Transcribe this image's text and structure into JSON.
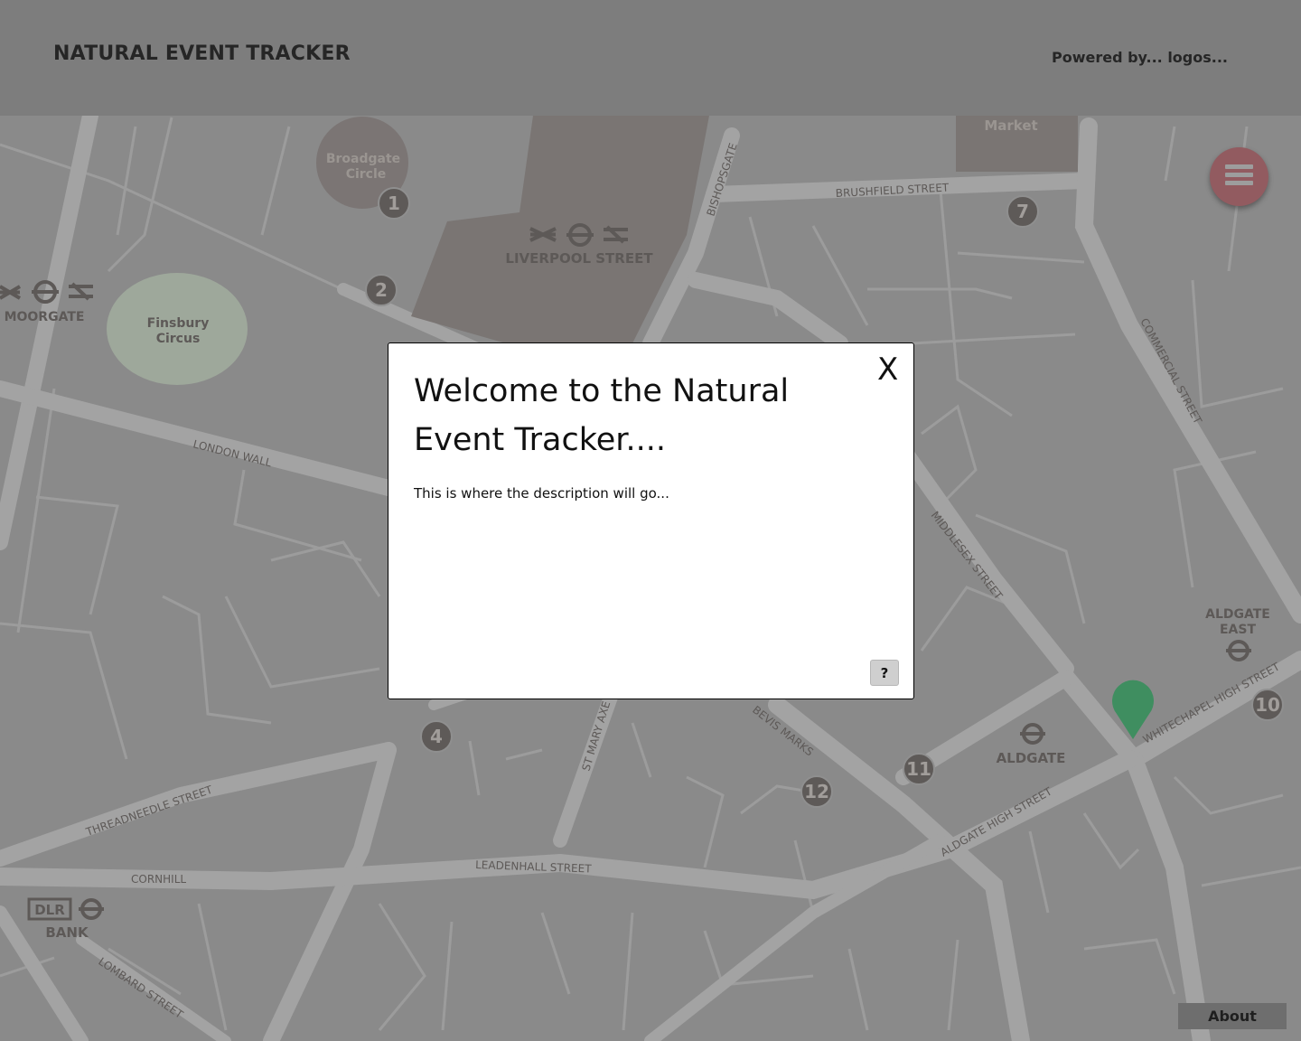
{
  "header": {
    "title": "NATURAL EVENT TRACKER",
    "powered_by": "Powered by... logos..."
  },
  "map": {
    "labels": {
      "broadgate_line1": "Broadgate",
      "broadgate_line2": "Circle",
      "liverpool_street": "LIVERPOOL STREET",
      "moorgate": "MOORGATE",
      "finsbury_line1": "Finsbury",
      "finsbury_line2": "Circus",
      "bishopsgate": "BISHOPSGATE",
      "brushfield_street": "BRUSHFIELD STREET",
      "market": "Market",
      "commercial_street": "COMMERCIAL STREET",
      "london_wall": "LONDON WALL",
      "middlesex_street": "MIDDLESEX STREET",
      "aldgate_east_line1": "ALDGATE",
      "aldgate_east_line2": "EAST",
      "whitechapel_high_street": "WHITECHAPEL HIGH STREET",
      "aldgate": "ALDGATE",
      "aldgate_high_street": "ALDGATE HIGH STREET",
      "bevis_marks": "BEVIS MARKS",
      "st_mary_axe": "ST MARY AXE",
      "threadneedle_street": "THREADNEEDLE STREET",
      "cornhill": "CORNHILL",
      "leadenhall_street": "LEADENHALL STREET",
      "dlr": "DLR",
      "bank": "BANK",
      "lombard_street": "LOMBARD STREET"
    },
    "markers": [
      "1",
      "2",
      "4",
      "7",
      "10",
      "11",
      "12"
    ],
    "colors": {
      "road": "#a3a3a3",
      "marker": "#5e5a58",
      "park": "#9ea89b",
      "building": "#7a7573",
      "pin": "#3f8e60"
    }
  },
  "menu": {
    "icon": "hamburger-menu-icon"
  },
  "modal": {
    "title": "Welcome to the Natural Event Tracker....",
    "close_label": "X",
    "description": "This is where the description will go...",
    "help_label": "?"
  },
  "footer": {
    "about_label": "About"
  }
}
